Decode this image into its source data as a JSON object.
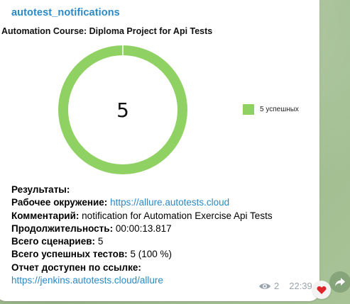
{
  "message": {
    "channel_name": "autotest_notifications",
    "views": "2",
    "time": "22:39"
  },
  "colors": {
    "success": "#8fd163",
    "link": "#2a8ac7"
  },
  "icons": {
    "views": "eye-icon",
    "reaction": "heart-icon",
    "forward": "forward-arrow-icon"
  },
  "chart_data": {
    "type": "pie",
    "title": "Automation Course: Diploma Project for Api Tests",
    "center_label": "5",
    "slices": [
      {
        "label": "5 успешных",
        "value": 5,
        "color": "#8fd163"
      }
    ],
    "legend_position": "right"
  },
  "results": {
    "heading": "Результаты:",
    "env_label": "Рабочее окружение:",
    "env_link": "https://allure.autotests.cloud",
    "comment_label": "Комментарий:",
    "comment_value": "notification for Automation Exercise Api Tests",
    "duration_label": "Продолжительность:",
    "duration_value": "00:00:13.817",
    "scenarios_label": "Всего сценариев:",
    "scenarios_value": "5",
    "passed_label": "Всего успешных тестов:",
    "passed_value": "5 (100 %)",
    "report_label": "Отчет доступен по ссылке:",
    "report_link": "https://jenkins.autotests.cloud/allure"
  }
}
